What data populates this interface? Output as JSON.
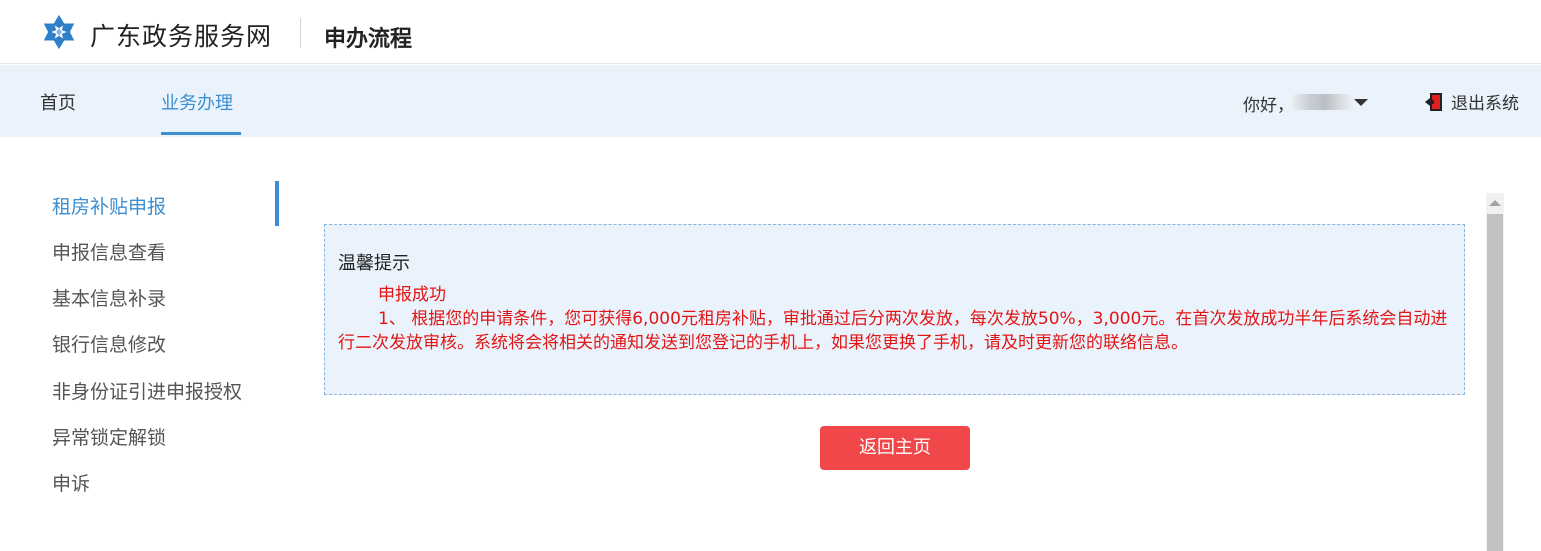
{
  "header": {
    "site_name": "广东政务服务网",
    "page_title": "申办流程",
    "logo_icon": "snowflake-logo-icon",
    "brand_color": "#2f80c8"
  },
  "nav": {
    "items": [
      {
        "label": "首页",
        "active": false
      },
      {
        "label": "业务办理",
        "active": true
      }
    ],
    "greeting": "你好，",
    "logout_label": "退出系统",
    "logout_icon": "exit-door-icon",
    "accent": "#3d8fd1",
    "background": "#eaf3fb"
  },
  "sidebar": {
    "items": [
      {
        "label": "租房补贴申报",
        "active": true
      },
      {
        "label": "申报信息查看",
        "active": false
      },
      {
        "label": "基本信息补录",
        "active": false
      },
      {
        "label": "银行信息修改",
        "active": false
      },
      {
        "label": "非身份证引进申报授权",
        "active": false
      },
      {
        "label": "异常锁定解锁",
        "active": false
      },
      {
        "label": "申诉",
        "active": false
      }
    ]
  },
  "notice": {
    "title": "温馨提示",
    "status": "申报成功",
    "message": "1、 根据您的申请条件，您可获得6,000元租房补贴，审批通过后分两次发放，每次发放50%，3,000元。在首次发放成功半年后系统会自动进行二次发放审核。系统将会将相关的通知发送到您登记的手机上，如果您更换了手机，请及时更新您的联络信息。",
    "text_color": "#e21515"
  },
  "actions": {
    "return_label": "返回主页",
    "return_color": "#f0474a"
  }
}
